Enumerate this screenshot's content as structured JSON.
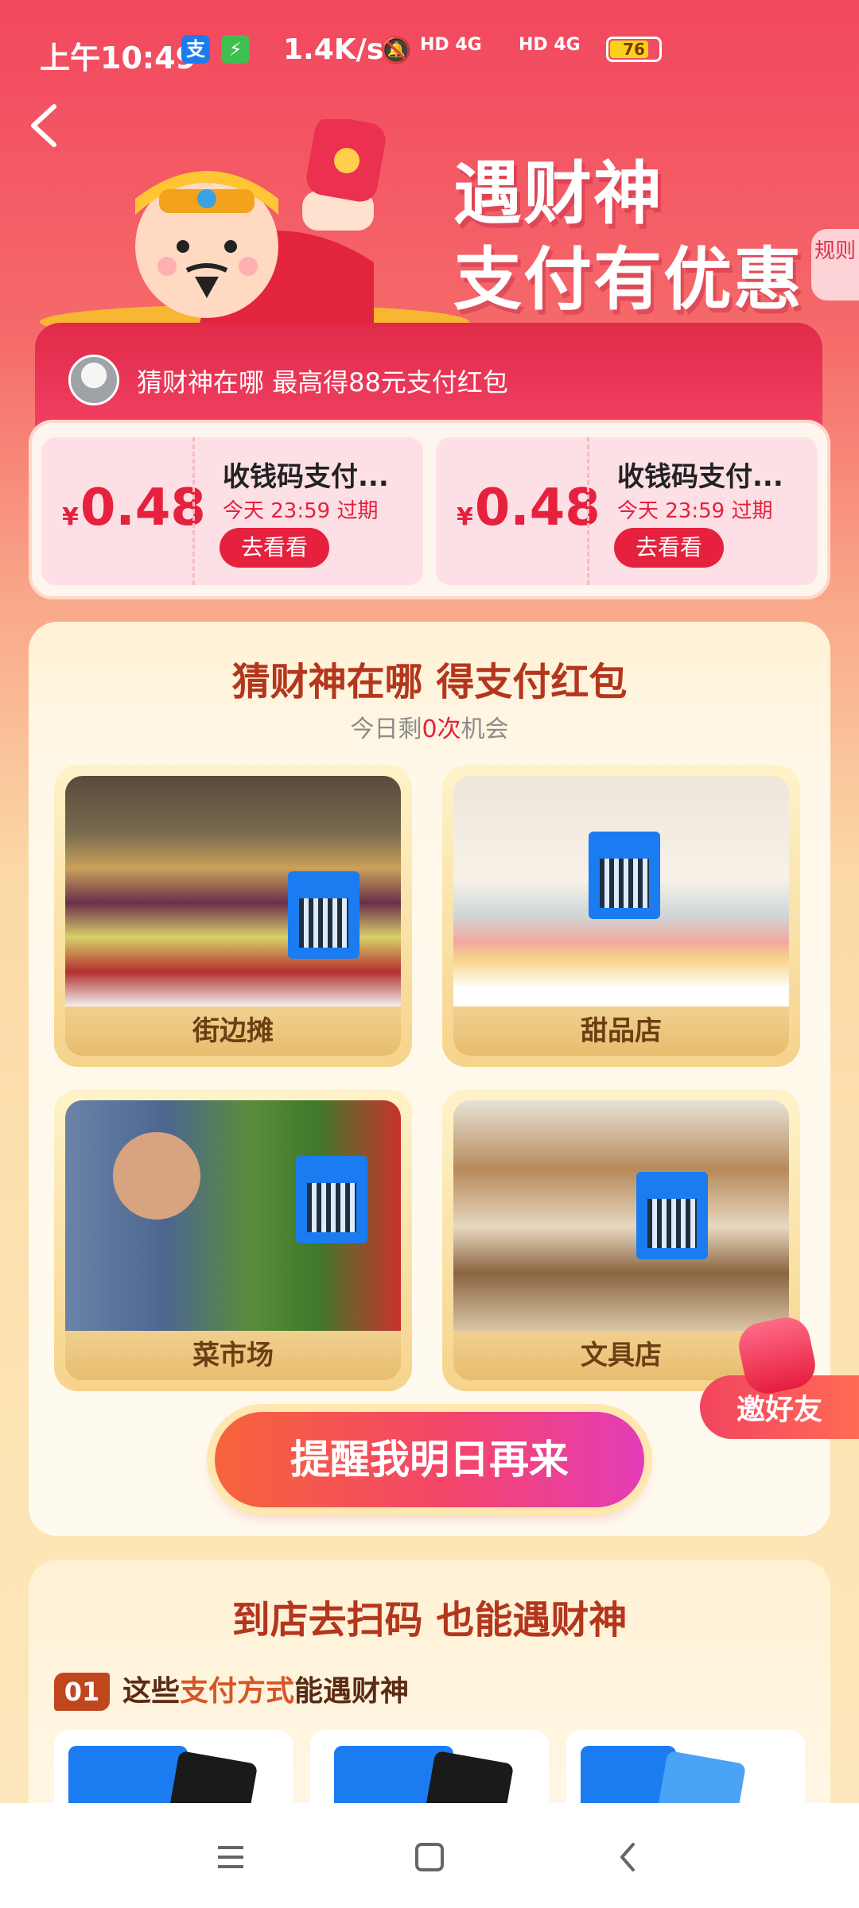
{
  "status": {
    "time": "上午10:49",
    "speed": "1.4K/s",
    "net1": "HD 4G",
    "net2": "HD 4G",
    "battery": "76",
    "battery_level": 0.76
  },
  "hero": {
    "title_line1": "遇财神",
    "title_line2": "支付有优惠",
    "rules_label": "规则"
  },
  "banner": {
    "text": "猜财神在哪 最高得88元支付红包"
  },
  "coupons": [
    {
      "currency": "¥",
      "amount": "0.48",
      "title": "收钱码支付...",
      "expire": "今天 23:59 过期",
      "button": "去看看"
    },
    {
      "currency": "¥",
      "amount": "0.48",
      "title": "收钱码支付...",
      "expire": "今天 23:59 过期",
      "button": "去看看"
    }
  ],
  "main": {
    "title": "猜财神在哪 得支付红包",
    "sub_prefix": "今日剩",
    "sub_count": "0次",
    "sub_suffix": "机会",
    "tiles": [
      {
        "label": "街边摊"
      },
      {
        "label": "甜品店"
      },
      {
        "label": "菜市场"
      },
      {
        "label": "文具店"
      }
    ],
    "remind_button": "提醒我明日再来"
  },
  "invite": {
    "label": "邀好友"
  },
  "card2": {
    "title": "到店去扫码 也能遇财神",
    "step_number": "01",
    "step_prefix": "这些",
    "step_highlight": "支付方式",
    "step_suffix": "能遇财神"
  },
  "colors": {
    "brand_red": "#e5213d",
    "alipay_blue": "#1a7cf0",
    "title_brown": "#b3361d"
  }
}
